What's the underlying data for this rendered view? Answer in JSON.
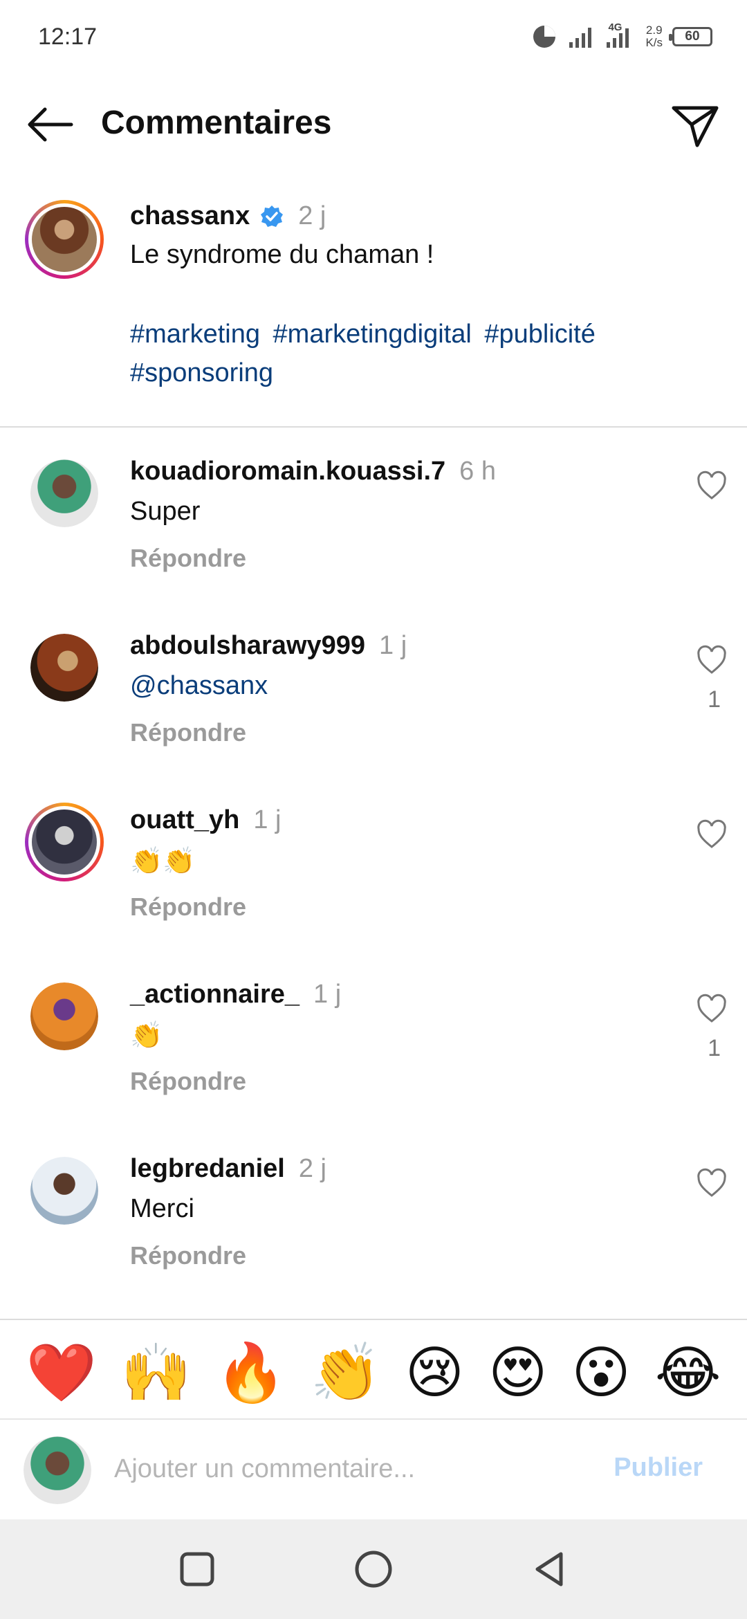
{
  "status_bar": {
    "time": "12:17",
    "network": "4G",
    "speed_top": "2.9",
    "speed_bottom": "K/s",
    "battery": "60"
  },
  "header": {
    "title": "Commentaires"
  },
  "caption": {
    "username": "chassanx",
    "time": "2 j",
    "text": "Le syndrome du chaman !",
    "hashtags": [
      "#marketing",
      "#marketingdigital",
      "#publicité",
      "#sponsoring"
    ]
  },
  "comments": [
    {
      "username": "kouadioromain.kouassi.7",
      "time": "6 h",
      "text": "Super",
      "reply": "Répondre",
      "likes": "",
      "avatar_color": "#4a8f6a"
    },
    {
      "username": "abdoulsharawy999",
      "time": "1 j",
      "text": "@chassanx",
      "reply": "Répondre",
      "likes": "1",
      "avatar_color": "#7a3b1c"
    },
    {
      "username": "ouatt_yh",
      "time": "1 j",
      "text": "👏👏",
      "reply": "Répondre",
      "likes": "",
      "avatar_color": "#3a3a4a"
    },
    {
      "username": "_actionnaire_",
      "time": "1 j",
      "text": "👏",
      "reply": "Répondre",
      "likes": "1",
      "avatar_color": "#e8892a"
    },
    {
      "username": "legbredaniel",
      "time": "2 j",
      "text": "Merci",
      "reply": "Répondre",
      "likes": "",
      "avatar_color": "#9aa8b6"
    }
  ],
  "emoji_bar": [
    "❤️",
    "🙌",
    "🔥",
    "👏",
    "😢",
    "😍",
    "😮",
    "😂"
  ],
  "input": {
    "placeholder": "Ajouter un commentaire...",
    "publish_label": "Publier"
  },
  "colors": {
    "hashtag": "#0a3d7a",
    "muted": "#9a9a9a",
    "publish_disabled": "#b9d7f7",
    "verified": "#3897f0"
  }
}
